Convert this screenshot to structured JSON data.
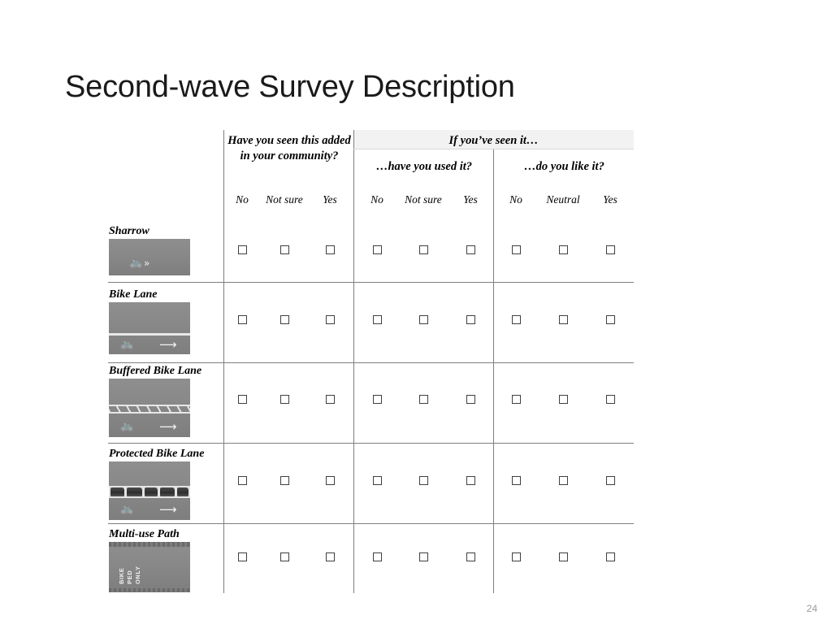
{
  "slide": {
    "title": "Second-wave Survey Description",
    "page_number": "24"
  },
  "table": {
    "headers": {
      "seen": "Have you seen this added in your community?",
      "if_seen": "If you’ve seen it…",
      "used": "…have you used it?",
      "like": "…do you like it?"
    },
    "option_groups": [
      {
        "name": "seen",
        "options": [
          "No",
          "Not sure",
          "Yes"
        ]
      },
      {
        "name": "used",
        "options": [
          "No",
          "Not sure",
          "Yes"
        ]
      },
      {
        "name": "like",
        "options": [
          "No",
          "Neutral",
          "Yes"
        ]
      }
    ],
    "rows": [
      {
        "label": "Sharrow",
        "image": "sharrow-photo"
      },
      {
        "label": "Bike Lane",
        "image": "bike-lane-photo"
      },
      {
        "label": "Buffered Bike Lane",
        "image": "buffered-bike-lane-photo"
      },
      {
        "label": "Protected Bike Lane",
        "image": "protected-bike-lane-photo"
      },
      {
        "label": "Multi-use Path",
        "image": "multi-use-path-photo"
      }
    ],
    "path_sign": {
      "line1": "BIKE",
      "line2": "PED",
      "line3": "ONLY"
    }
  },
  "colors": {
    "rule": "#7f7f7f",
    "band": "#f2f2f2",
    "checkbox_border": "#404040",
    "page_number": "#9a9a9a",
    "asphalt": "#8a8a8a",
    "markings": "#f0f0f0"
  }
}
